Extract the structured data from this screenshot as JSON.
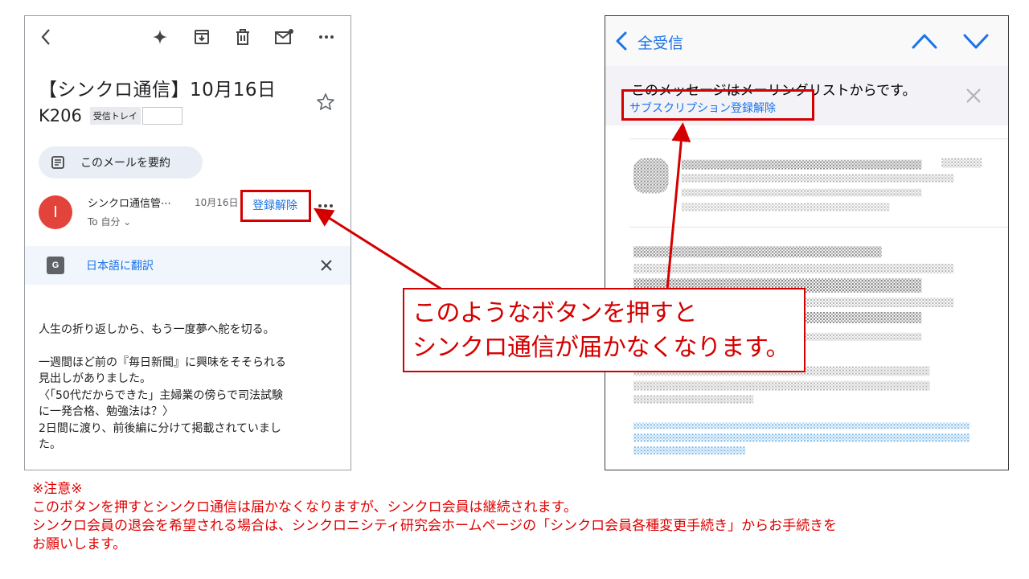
{
  "gmail": {
    "subject_line1": "【シンクロ通信】10月16日",
    "subject_line2": "K206",
    "label": "受信トレイ",
    "summarize_label": "このメールを要約",
    "avatar_letter": "I",
    "sender": "シンクロ通信管⋯",
    "date": "10月16日",
    "to": "To 自分 ⌄",
    "unsubscribe_label": "登録解除",
    "translate_label": "日本語に翻訳",
    "body": [
      "人生の折り返しから、もう一度夢へ舵を切る。",
      "",
      "一週間ほど前の『毎日新聞』に興味をそそられる",
      "見出しがありました。",
      "〈「50代だからできた」主婦業の傍らで司法試験",
      "に一発合格、勉強法は？〉",
      "2日間に渡り、前後編に分けて掲載されていまし",
      "た。"
    ],
    "icons": [
      "back-icon",
      "sparkle-icon",
      "archive-icon",
      "trash-icon",
      "mark-unread-icon",
      "more-icon",
      "star-icon",
      "summary-icon",
      "translate-icon",
      "close-icon"
    ]
  },
  "ios_mail": {
    "back_label": "全受信",
    "banner_text": "このメッセージはメーリングリストからです。",
    "banner_link": "サブスクリプション登録解除",
    "icons": [
      "chevron-left-icon",
      "chevron-up-icon",
      "chevron-down-icon",
      "close-icon"
    ]
  },
  "callout": {
    "line1": "このようなボタンを押すと",
    "line2": "シンクロ通信が届かなくなります。"
  },
  "note": {
    "title": "※注意※",
    "line1": "このボタンを押すとシンクロ通信は届かなくなりますが、シンクロ会員は継続されます。",
    "line2": "シンクロ会員の退会を希望される場合は、シンクロニシティ研究会ホームページの「シンクロ会員各種変更手続き」からお手続きを",
    "line3": "お願いします。"
  },
  "colors": {
    "annotation_red": "#d40000",
    "link_blue": "#1a73e8",
    "avatar_red": "#e2433b"
  }
}
